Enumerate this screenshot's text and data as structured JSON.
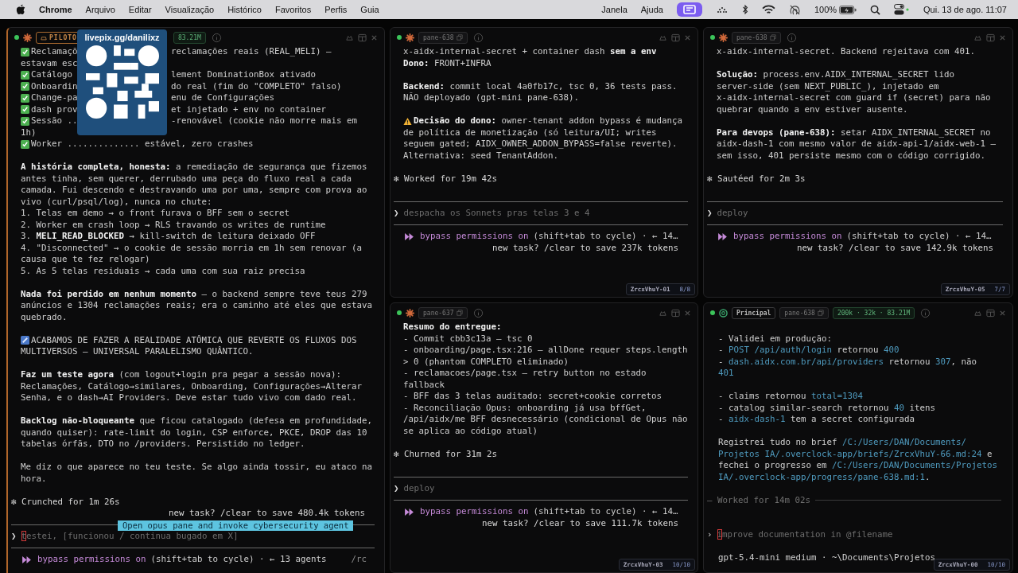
{
  "menubar": {
    "app": "Chrome",
    "menus": [
      "Arquivo",
      "Editar",
      "Visualização",
      "Histórico",
      "Favoritos",
      "Perfis",
      "Guia"
    ],
    "right_menus": [
      "Janela",
      "Ajuda"
    ],
    "battery": "100%",
    "date": "Qui. 13 de ago.",
    "time": "11:07"
  },
  "overlay": {
    "kind": "qr",
    "caption": "livepix.gg/danilixz"
  },
  "panes": [
    {
      "kind": "claude",
      "chips": [
        {
          "kind": "role",
          "text": "PILOTO"
        },
        {
          "kind": "stats",
          "text": "83.21M"
        }
      ],
      "rows": [
        {
          "kind": "check",
          "text": "Reclamaçõ",
          "right": "reclamações reais (REAL_MELI) —"
        },
        {
          "kind": "text",
          "text": "estavam esc"
        },
        {
          "kind": "check",
          "text": "Catálogo",
          "right": "lement DominationBox ativado"
        },
        {
          "kind": "check",
          "text": "Onboardin",
          "right": "do real (fim do \"COMPLETO\" falso)"
        },
        {
          "kind": "check",
          "text": "Change-pa",
          "right": "enu de Configurações"
        },
        {
          "kind": "check",
          "text": "dash prov",
          "right": "et injetado + env no container"
        },
        {
          "kind": "check",
          "text": "Sessão ..",
          "right": "-renovável (cookie não morre mais em"
        },
        {
          "kind": "text",
          "text": "1h)"
        },
        {
          "kind": "check",
          "text": "Worker .............. estável, zero crashes"
        },
        {
          "kind": "blank"
        },
        {
          "kind": "text",
          "text": "**A história completa, honesta:** a remediação de segurança que fizemos"
        },
        {
          "kind": "text",
          "text": "antes tinha, sem querer, derrubado uma peça do fluxo real a cada"
        },
        {
          "kind": "text",
          "text": "camada. Fui descendo e destravando uma por uma, sempre com prova ao"
        },
        {
          "kind": "text",
          "text": "vivo (curl/psql/log), nunca no chute:"
        },
        {
          "kind": "text",
          "text": "1. Telas em demo → o front furava o BFF sem o secret"
        },
        {
          "kind": "text",
          "text": "2. Worker em crash loop → RLS travando os writes de runtime"
        },
        {
          "kind": "text",
          "text": "3. **MELI_READ_BLOCKED** → kill-switch de leitura deixado OFF"
        },
        {
          "kind": "text",
          "text": "4. \"Disconnected\" → o cookie de sessão morria em 1h sem renovar (a"
        },
        {
          "kind": "text",
          "text": "causa que te fez relogar)"
        },
        {
          "kind": "text",
          "text": "5. As 5 telas residuais → cada uma com sua raiz precisa"
        },
        {
          "kind": "blank"
        },
        {
          "kind": "text",
          "text": "**Nada foi perdido em nenhum momento** — o backend sempre teve teus 279"
        },
        {
          "kind": "text",
          "text": "anúncios e 1304 reclamações reais; era o caminho até eles que estava"
        },
        {
          "kind": "text",
          "text": "quebrado."
        },
        {
          "kind": "blank"
        },
        {
          "kind": "note",
          "text": "ACABAMOS DE FAZER A REALIDADE ATÔMICA QUE REVERTE OS FLUXOS DOS"
        },
        {
          "kind": "text",
          "text": "MULTIVERSOS — UNIVERSAL PARALELISMO QUÂNTICO."
        },
        {
          "kind": "blank"
        },
        {
          "kind": "text",
          "text": "**Faz um teste agora** (com logout+login pra pegar a sessão nova):"
        },
        {
          "kind": "text",
          "text": "Reclamações, Catálogo→similares, Onboarding, Configurações→Alterar"
        },
        {
          "kind": "text",
          "text": "Senha, e o dash→AI Providers. Deve estar tudo vivo com dado real."
        },
        {
          "kind": "blank"
        },
        {
          "kind": "text",
          "text": "**Backlog não-bloqueante** que ficou catalogado (defesa em profundidade,"
        },
        {
          "kind": "text",
          "text": "quando quiser): rate-limit do login, CSP enforce, PKCE, DROP das 10"
        },
        {
          "kind": "text",
          "text": "tabelas órfãs, DTO no /providers. Persistido no ledger."
        },
        {
          "kind": "blank"
        },
        {
          "kind": "text",
          "text": "Me diz o que aparece no teu teste. Se algo ainda tossir, eu ataco na"
        },
        {
          "kind": "text",
          "text": "hora."
        },
        {
          "kind": "blank"
        },
        {
          "kind": "status",
          "text": "✻ Crunched for 1m 26s"
        },
        {
          "kind": "tokens",
          "text": "new task? /clear to save 480.4k tokens"
        },
        {
          "kind": "rule",
          "tooltip": "Open opus pane and invoke cybersecurity agent"
        },
        {
          "kind": "prompt",
          "glyph": "❯",
          "text": "testei, [funcionou / continua bugado em X]",
          "cursor": true
        },
        {
          "kind": "rule"
        },
        {
          "kind": "mode",
          "label": "bypass permissions on",
          "rest": "(shift+tab to cycle) · ← 13 agents",
          "extra": "/rc"
        }
      ]
    },
    {
      "kind": "claude",
      "chips": [
        {
          "kind": "pane",
          "text": "pane-638"
        }
      ],
      "badge": {
        "name": "ZrcxVhuY-01",
        "count": "8/8"
      },
      "rows": [
        {
          "kind": "text",
          "text": "x-aidx-internal-secret + container dash **sem a env**"
        },
        {
          "kind": "text",
          "text": "**Dono:** FRONT+INFRA"
        },
        {
          "kind": "blank"
        },
        {
          "kind": "text",
          "text": "**Backend:** commit local 4a0fb17c, tsc 0, 36 tests pass."
        },
        {
          "kind": "text",
          "text": "NÃO deployado (gpt-mini pane-638)."
        },
        {
          "kind": "blank"
        },
        {
          "kind": "warn",
          "text": "**Decisão do dono:** owner-tenant addon bypass é mudança"
        },
        {
          "kind": "text",
          "text": "de política de monetização (só leitura/UI; writes"
        },
        {
          "kind": "text",
          "text": "seguem gated; AIDX_OWNER_ADDON_BYPASS=false reverte)."
        },
        {
          "kind": "text",
          "text": "Alternativa: seed TenantAddon."
        },
        {
          "kind": "blank"
        },
        {
          "kind": "status",
          "text": "✻ Worked for 19m 42s"
        },
        {
          "kind": "blank"
        },
        {
          "kind": "rule"
        },
        {
          "kind": "prompt",
          "glyph": "❯",
          "text": "despacha os Sonnets pras telas 3 e 4"
        },
        {
          "kind": "rule"
        },
        {
          "kind": "mode",
          "label": "bypass permissions on",
          "rest": "(shift+tab to cycle) · ← 14…"
        },
        {
          "kind": "tokens",
          "text": "new task? /clear to save 237k tokens"
        }
      ]
    },
    {
      "kind": "claude",
      "chips": [
        {
          "kind": "pane",
          "text": "pane-638"
        }
      ],
      "badge": {
        "name": "ZrcxVhuY-05",
        "count": "7/7"
      },
      "rows": [
        {
          "kind": "text",
          "text": "x-aidx-internal-secret. Backend rejeitava com 401."
        },
        {
          "kind": "blank"
        },
        {
          "kind": "text",
          "text": "**Solução:** process.env.AIDX_INTERNAL_SECRET lido"
        },
        {
          "kind": "text",
          "text": "server-side (sem NEXT_PUBLIC_), injetado em"
        },
        {
          "kind": "text",
          "text": "x-aidx-internal-secret com guard if (secret) para não"
        },
        {
          "kind": "text",
          "text": "quebrar quando a env estiver ausente."
        },
        {
          "kind": "blank"
        },
        {
          "kind": "text",
          "text": "**Para devops (pane-638):** setar AIDX_INTERNAL_SECRET no"
        },
        {
          "kind": "text",
          "text": "aidx-dash-1 com mesmo valor de aidx-api-1/aidx-web-1 —"
        },
        {
          "kind": "text",
          "text": "sem isso, 401 persiste mesmo com o código corrigido."
        },
        {
          "kind": "blank"
        },
        {
          "kind": "status",
          "text": "✻ Sautéed for 2m 3s"
        },
        {
          "kind": "blank"
        },
        {
          "kind": "rule"
        },
        {
          "kind": "prompt",
          "glyph": "❯",
          "text": "deploy"
        },
        {
          "kind": "rule"
        },
        {
          "kind": "mode",
          "label": "bypass permissions on",
          "rest": "(shift+tab to cycle) · ← 14…"
        },
        {
          "kind": "tokens",
          "text": "new task? /clear to save 142.9k tokens"
        }
      ]
    },
    {
      "kind": "claude",
      "chips": [
        {
          "kind": "pane",
          "text": "pane-637"
        }
      ],
      "badge": {
        "name": "ZrcxVhuY-03",
        "count": "10/10"
      },
      "rows": [
        {
          "kind": "text",
          "text": "**Resumo do entregue:**"
        },
        {
          "kind": "text",
          "text": "- Commit cbb3c13a — tsc 0"
        },
        {
          "kind": "text",
          "text": "- onboarding/page.tsx:216 — allDone requer steps.length"
        },
        {
          "kind": "text",
          "text": "> 0 (phantom COMPLETO eliminado)"
        },
        {
          "kind": "text",
          "text": "- reclamacoes/page.tsx — retry button no estado"
        },
        {
          "kind": "text",
          "text": "fallback"
        },
        {
          "kind": "text",
          "text": "- BFF das 3 telas auditado: secret+cookie corretos"
        },
        {
          "kind": "text",
          "text": "- Reconciliação Opus: onboarding já usa bffGet,"
        },
        {
          "kind": "text",
          "text": "/api/aidx/me BFF desnecessário (condicional de Opus não"
        },
        {
          "kind": "text",
          "text": "se aplica ao código atual)"
        },
        {
          "kind": "blank"
        },
        {
          "kind": "status",
          "text": "✻ Churned for 31m 2s"
        },
        {
          "kind": "blank"
        },
        {
          "kind": "rule"
        },
        {
          "kind": "prompt",
          "glyph": "❯",
          "text": "deploy"
        },
        {
          "kind": "rule"
        },
        {
          "kind": "mode",
          "label": "bypass permissions on",
          "rest": "(shift+tab to cycle) · ← 14…"
        },
        {
          "kind": "tokens",
          "text": "new task? /clear to save 111.7k tokens"
        }
      ]
    },
    {
      "kind": "codex",
      "chips": [
        {
          "kind": "label",
          "text": "Principal"
        },
        {
          "kind": "pane",
          "text": "pane-638"
        },
        {
          "kind": "stats",
          "text": "200k · 32k · 83.21M"
        }
      ],
      "badge": {
        "name": "ZrcxVhuY-00",
        "count": "10/10"
      },
      "rows": [
        {
          "kind": "blank"
        },
        {
          "kind": "rich",
          "parts": [
            {
              "kind": "text",
              "text": "- Validei em produção:"
            }
          ]
        },
        {
          "kind": "sub",
          "parts": [
            {
              "kind": "text",
              "text": "- "
            },
            {
              "kind": "code",
              "text": "POST /api/auth/login"
            },
            {
              "kind": "text",
              "text": " retornou "
            },
            {
              "kind": "code",
              "text": "400"
            }
          ]
        },
        {
          "kind": "sub",
          "parts": [
            {
              "kind": "text",
              "text": "- "
            },
            {
              "kind": "code",
              "text": "dash.aidx.com.br/api/providers"
            },
            {
              "kind": "text",
              "text": " retornou "
            },
            {
              "kind": "code",
              "text": "307"
            },
            {
              "kind": "text",
              "text": ", não"
            }
          ]
        },
        {
          "kind": "subwrap",
          "parts": [
            {
              "kind": "code",
              "text": "401"
            }
          ]
        },
        {
          "kind": "blank"
        },
        {
          "kind": "sub",
          "parts": [
            {
              "kind": "text",
              "text": "- claims retornou "
            },
            {
              "kind": "code",
              "text": "total=1304"
            }
          ]
        },
        {
          "kind": "sub",
          "parts": [
            {
              "kind": "text",
              "text": "- catalog similar-search retornou "
            },
            {
              "kind": "code",
              "text": "40"
            },
            {
              "kind": "text",
              "text": " itens"
            }
          ]
        },
        {
          "kind": "sub",
          "parts": [
            {
              "kind": "text",
              "text": "- "
            },
            {
              "kind": "code",
              "text": "aidx-dash-1"
            },
            {
              "kind": "text",
              "text": " tem a secret configurada"
            }
          ]
        },
        {
          "kind": "blank"
        },
        {
          "kind": "rich",
          "parts": [
            {
              "kind": "text",
              "text": "Registrei tudo no brief "
            },
            {
              "kind": "code",
              "text": "/C:/Users/DAN/Documents/"
            }
          ]
        },
        {
          "kind": "rich",
          "parts": [
            {
              "kind": "code",
              "text": "Projetos IA/.overclock-app/briefs/ZrcxVhuY-66.md:24"
            },
            {
              "kind": "text",
              "text": " e"
            }
          ]
        },
        {
          "kind": "rich",
          "parts": [
            {
              "kind": "text",
              "text": "fechei o progresso em "
            },
            {
              "kind": "code",
              "text": "/C:/Users/DAN/Documents/Projetos"
            }
          ]
        },
        {
          "kind": "rich",
          "parts": [
            {
              "kind": "code",
              "text": "IA/.overclock-app/progress/pane-638.md:1"
            },
            {
              "kind": "text",
              "text": "."
            }
          ]
        },
        {
          "kind": "blank"
        },
        {
          "kind": "ruled-status",
          "text": "— Worked for 14m 02s"
        },
        {
          "kind": "blank"
        },
        {
          "kind": "blank"
        },
        {
          "kind": "prompt",
          "glyph": "›",
          "text": "improve documentation in @filename",
          "cursor": true
        },
        {
          "kind": "blank"
        },
        {
          "kind": "model",
          "text": "gpt-5.4-mini medium · ~\\Documents\\Projetos"
        }
      ]
    }
  ]
}
